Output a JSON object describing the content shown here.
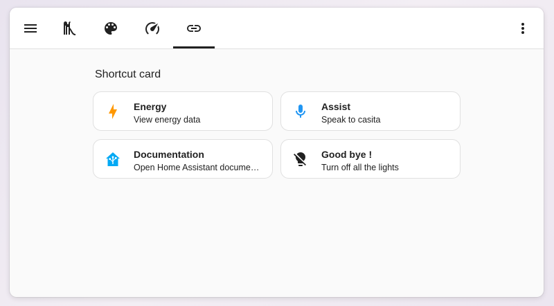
{
  "toolbar": {
    "icons": [
      "menu-icon",
      "slide-icon",
      "palette-icon",
      "gauge-icon",
      "link-icon",
      "more-vert-icon"
    ],
    "active_tab": "link"
  },
  "section": {
    "title": "Shortcut card"
  },
  "cards": [
    {
      "title": "Energy",
      "subtitle": "View energy data",
      "icon": "flash-icon",
      "icon_color": "#ff9800"
    },
    {
      "title": "Assist",
      "subtitle": "Speak to casita",
      "icon": "microphone-icon",
      "icon_color": "#2196f3"
    },
    {
      "title": "Documentation",
      "subtitle": "Open Home Assistant documentation",
      "icon": "home-assistant-icon",
      "icon_color": "#03a9f4"
    },
    {
      "title": "Good bye !",
      "subtitle": "Turn off all the lights",
      "icon": "lightbulb-off-icon",
      "icon_color": "#212121"
    }
  ]
}
